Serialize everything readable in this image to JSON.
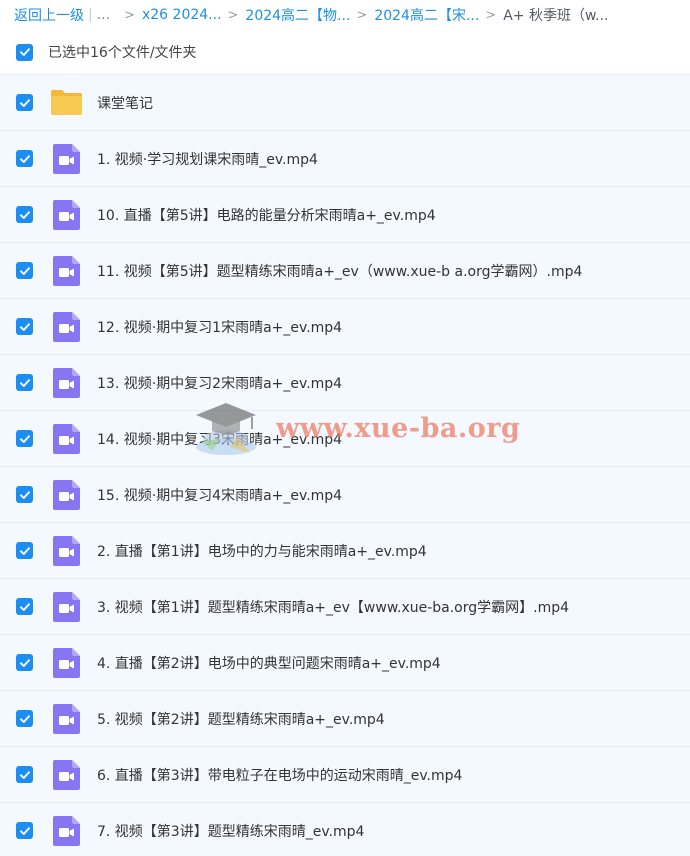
{
  "breadcrumb": {
    "back": "返回上一级",
    "separator": "|",
    "ellipsis": "...",
    "crumbs": [
      "x26 2024...",
      "2024高二【物...",
      "2024高二【宋...",
      "A+ 秋季班（w..."
    ]
  },
  "selection": {
    "label": "已选中16个文件/文件夹",
    "checked": true
  },
  "watermark": "www.xue-ba.org",
  "colors": {
    "accent": "#1c8ef1",
    "link": "#1e8fe6",
    "row_bg": "#f4f9ff",
    "folder": "#f8c950",
    "video": "#8776f1"
  },
  "files": [
    {
      "name": "课堂笔记",
      "type": "folder",
      "icon": "folder-icon",
      "checked": true
    },
    {
      "name": "1. 视频·学习规划课宋雨晴_ev.mp4",
      "type": "video",
      "icon": "video-file-icon",
      "checked": true
    },
    {
      "name": "10. 直播【第5讲】电路的能量分析宋雨晴a+_ev.mp4",
      "type": "video",
      "icon": "video-file-icon",
      "checked": true
    },
    {
      "name": "11. 视频【第5讲】题型精练宋雨晴a+_ev（www.xue-b a.org学霸网）.mp4",
      "type": "video",
      "icon": "video-file-icon",
      "checked": true
    },
    {
      "name": "12. 视频·期中复习1宋雨晴a+_ev.mp4",
      "type": "video",
      "icon": "video-file-icon",
      "checked": true
    },
    {
      "name": "13. 视频·期中复习2宋雨晴a+_ev.mp4",
      "type": "video",
      "icon": "video-file-icon",
      "checked": true
    },
    {
      "name": "14. 视频·期中复习3宋雨晴a+_ev.mp4",
      "type": "video",
      "icon": "video-file-icon",
      "checked": true
    },
    {
      "name": "15. 视频·期中复习4宋雨晴a+_ev.mp4",
      "type": "video",
      "icon": "video-file-icon",
      "checked": true
    },
    {
      "name": "2. 直播【第1讲】电场中的力与能宋雨晴a+_ev.mp4",
      "type": "video",
      "icon": "video-file-icon",
      "checked": true
    },
    {
      "name": "3. 视频【第1讲】题型精练宋雨晴a+_ev【www.xue-ba.org学霸网】.mp4",
      "type": "video",
      "icon": "video-file-icon",
      "checked": true
    },
    {
      "name": "4. 直播【第2讲】电场中的典型问题宋雨晴a+_ev.mp4",
      "type": "video",
      "icon": "video-file-icon",
      "checked": true
    },
    {
      "name": "5. 视频【第2讲】题型精练宋雨晴a+_ev.mp4",
      "type": "video",
      "icon": "video-file-icon",
      "checked": true
    },
    {
      "name": "6. 直播【第3讲】带电粒子在电场中的运动宋雨晴_ev.mp4",
      "type": "video",
      "icon": "video-file-icon",
      "checked": true
    },
    {
      "name": "7. 视频【第3讲】题型精练宋雨晴_ev.mp4",
      "type": "video",
      "icon": "video-file-icon",
      "checked": true
    }
  ]
}
